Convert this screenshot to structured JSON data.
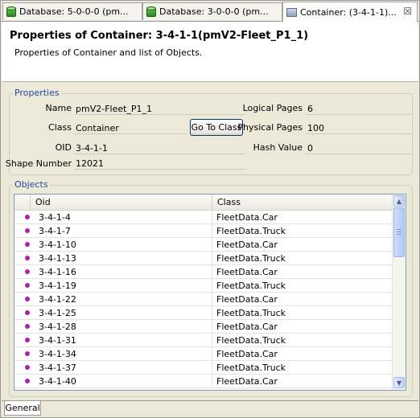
{
  "tabs": [
    {
      "label": "Database: 5-0-0-0 (pm...",
      "icon": "database-icon"
    },
    {
      "label": "Database: 3-0-0-0 (pm...",
      "icon": "database-icon"
    },
    {
      "label": "Container:  (3-4-1-1)...",
      "icon": "container-icon",
      "active": true,
      "close": "☒"
    }
  ],
  "header": {
    "title": "Properties of Container: 3-4-1-1(pmV2-Fleet_P1_1)",
    "subtitle": "Properties of Container and list of Objects."
  },
  "properties": {
    "legend": "Properties",
    "name_label": "Name",
    "name_value": "pmV2-Fleet_P1_1",
    "class_label": "Class",
    "class_value": "Container",
    "goto_button": "Go To Class",
    "oid_label": "OID",
    "oid_value": "3-4-1-1",
    "shape_label": "Shape Number",
    "shape_value": "12021",
    "logical_label": "Logical Pages",
    "logical_value": "6",
    "physical_label": "Physical Pages",
    "physical_value": "100",
    "hash_label": "Hash Value",
    "hash_value": "0"
  },
  "objects": {
    "legend": "Objects",
    "col_oid": "Oid",
    "col_class": "Class",
    "rows": [
      {
        "oid": "3-4-1-4",
        "class": "FleetData.Car"
      },
      {
        "oid": "3-4-1-7",
        "class": "FleetData.Truck"
      },
      {
        "oid": "3-4-1-10",
        "class": "FleetData.Car"
      },
      {
        "oid": "3-4-1-13",
        "class": "FleetData.Truck"
      },
      {
        "oid": "3-4-1-16",
        "class": "FleetData.Car"
      },
      {
        "oid": "3-4-1-19",
        "class": "FleetData.Truck"
      },
      {
        "oid": "3-4-1-22",
        "class": "FleetData.Car"
      },
      {
        "oid": "3-4-1-25",
        "class": "FleetData.Truck"
      },
      {
        "oid": "3-4-1-28",
        "class": "FleetData.Car"
      },
      {
        "oid": "3-4-1-31",
        "class": "FleetData.Truck"
      },
      {
        "oid": "3-4-1-34",
        "class": "FleetData.Car"
      },
      {
        "oid": "3-4-1-37",
        "class": "FleetData.Truck"
      },
      {
        "oid": "3-4-1-40",
        "class": "FleetData.Car"
      }
    ]
  },
  "bottom_tab": "General",
  "colors": {
    "accent": "#1f4aa5",
    "row_marker": "#b020b0"
  }
}
